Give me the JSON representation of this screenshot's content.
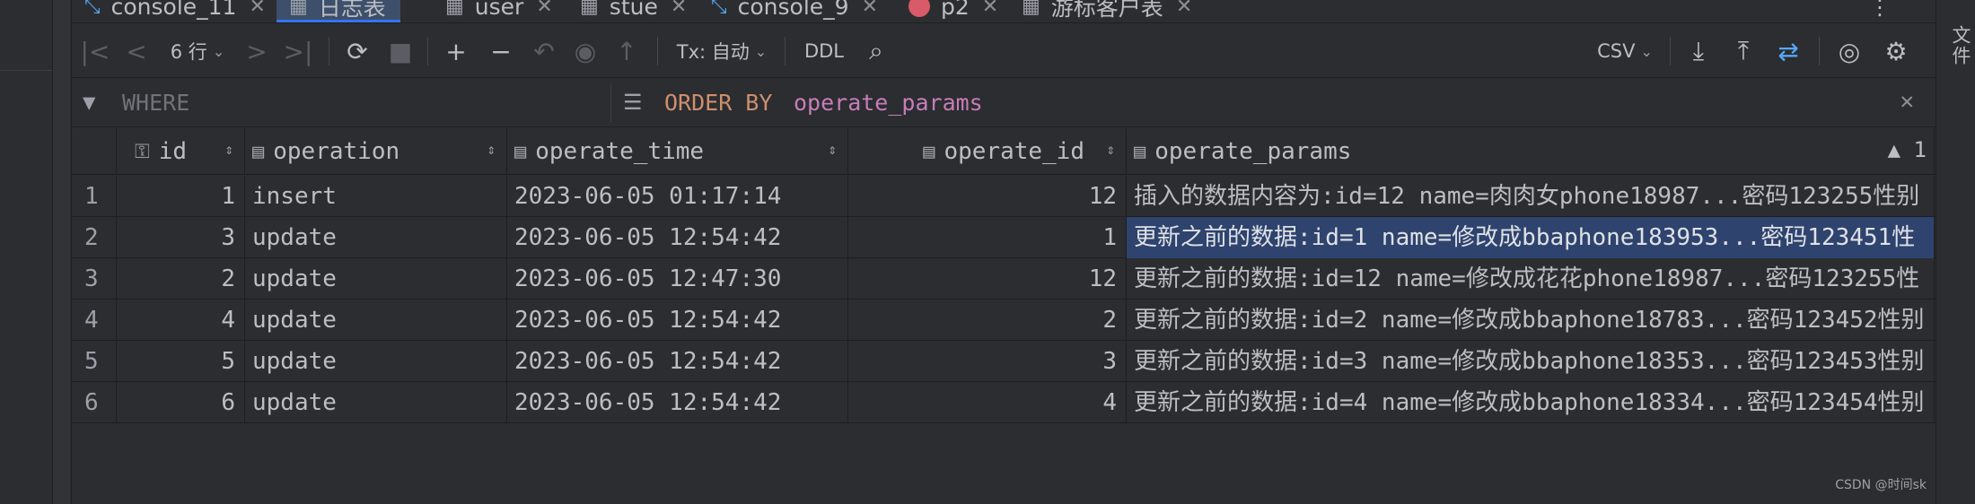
{
  "tabs": [
    {
      "label": "console_11",
      "icon": "console-icon",
      "active": false
    },
    {
      "label": "日志表",
      "icon": "table-icon",
      "active": true
    },
    {
      "label": "user",
      "icon": "table-icon",
      "active": false
    },
    {
      "label": "stue",
      "icon": "table-icon",
      "active": false
    },
    {
      "label": "console_9",
      "icon": "console-icon",
      "active": false
    },
    {
      "label": "p2",
      "icon": "p2-icon",
      "active": false
    },
    {
      "label": "游标客户表",
      "icon": "table-icon",
      "active": false
    }
  ],
  "toolbar": {
    "rows_label": "6 行",
    "tx_label": "Tx: 自动",
    "ddl_label": "DDL",
    "format_label": "CSV"
  },
  "filter": {
    "where_placeholder": "WHERE",
    "order_keyword": "ORDER BY",
    "order_value": "operate_params"
  },
  "columns": [
    {
      "name": "id"
    },
    {
      "name": "operation"
    },
    {
      "name": "operate_time"
    },
    {
      "name": "operate_id"
    },
    {
      "name": "operate_params",
      "sort_index": "1"
    }
  ],
  "rows": [
    {
      "n": "1",
      "id": "1",
      "operation": "insert",
      "operate_time": "2023-06-05 01:17:14",
      "operate_id": "12",
      "operate_params": "插入的数据内容为:id=12 name=肉肉女phone18987...密码123255性别"
    },
    {
      "n": "2",
      "id": "3",
      "operation": "update",
      "operate_time": "2023-06-05 12:54:42",
      "operate_id": "1",
      "operate_params": "更新之前的数据:id=1 name=修改成bbaphone183953...密码123451性"
    },
    {
      "n": "3",
      "id": "2",
      "operation": "update",
      "operate_time": "2023-06-05 12:47:30",
      "operate_id": "12",
      "operate_params": "更新之前的数据:id=12 name=修改成花花phone18987...密码123255性"
    },
    {
      "n": "4",
      "id": "4",
      "operation": "update",
      "operate_time": "2023-06-05 12:54:42",
      "operate_id": "2",
      "operate_params": "更新之前的数据:id=2 name=修改成bbaphone18783...密码123452性别"
    },
    {
      "n": "5",
      "id": "5",
      "operation": "update",
      "operate_time": "2023-06-05 12:54:42",
      "operate_id": "3",
      "operate_params": "更新之前的数据:id=3 name=修改成bbaphone18353...密码123453性别"
    },
    {
      "n": "6",
      "id": "6",
      "operation": "update",
      "operate_time": "2023-06-05 12:54:42",
      "operate_id": "4",
      "operate_params": "更新之前的数据:id=4 name=修改成bbaphone18334...密码123454性别"
    }
  ],
  "right_panel_label": "文件",
  "watermark": "CSDN @时间sk",
  "colors": {
    "accent": "#3574f0",
    "selection": "#2e436e",
    "keyword": "#cf8e6d",
    "identifier": "#c77dbb"
  }
}
